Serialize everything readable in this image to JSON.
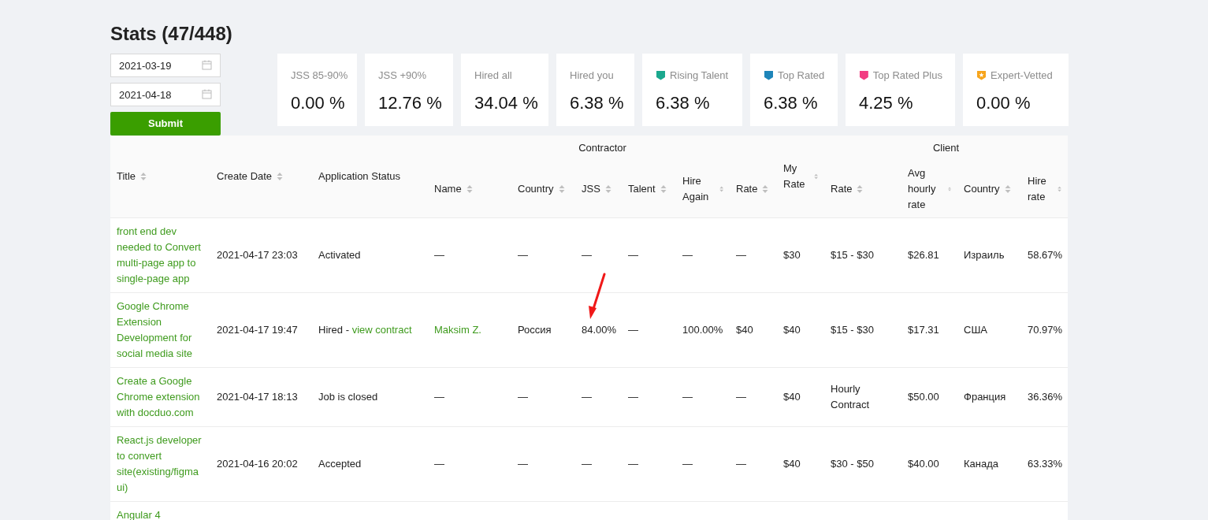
{
  "page_title": "Stats (47/448)",
  "filters": {
    "date_from": "2021-03-19",
    "date_to": "2021-04-18",
    "submit": "Submit"
  },
  "stats": [
    {
      "label": "JSS 85-90%",
      "value": "0.00 %"
    },
    {
      "label": "JSS +90%",
      "value": "12.76 %"
    },
    {
      "label": "Hired all",
      "value": "34.04 %"
    },
    {
      "label": "Hired you",
      "value": "6.38 %"
    },
    {
      "label": "Rising Talent",
      "value": "6.38 %",
      "badge": {
        "color": "#1aa88e",
        "star": false
      }
    },
    {
      "label": "Top Rated",
      "value": "6.38 %",
      "badge": {
        "color": "#1e85b9",
        "star": false
      }
    },
    {
      "label": "Top Rated Plus",
      "value": "4.25 %",
      "badge": {
        "color": "#f23d82",
        "star": false
      }
    },
    {
      "label": "Expert-Vetted",
      "value": "0.00 %",
      "badge": {
        "color": "#f7a51c",
        "star": true
      }
    }
  ],
  "table": {
    "header": [
      {
        "label": "Title",
        "sortable": true
      },
      {
        "label": "Create Date",
        "sortable": true
      },
      {
        "label": "Application Status",
        "sortable": false
      },
      {
        "group": "Contractor",
        "columns": [
          {
            "label": "Name",
            "sortable": true
          },
          {
            "label": "Country",
            "sortable": true
          },
          {
            "label": "JSS",
            "sortable": true
          },
          {
            "label": "Talent",
            "sortable": true
          },
          {
            "label": "Hire Again",
            "sortable": true
          },
          {
            "label": "Rate",
            "sortable": true
          }
        ]
      },
      {
        "label": "My Rate",
        "sortable": true
      },
      {
        "group": "Client",
        "columns": [
          {
            "label": "Rate",
            "sortable": true
          },
          {
            "label": "Avg hourly rate",
            "sortable": true
          },
          {
            "label": "Country",
            "sortable": true
          },
          {
            "label": "Hire rate",
            "sortable": true
          }
        ]
      }
    ],
    "rows": [
      {
        "cells": [
          {
            "kind": "link",
            "text": "front end dev needed to Convert multi-page app to single-page app"
          },
          {
            "kind": "text",
            "text": "2021-04-17 23:03"
          },
          {
            "kind": "text",
            "text": "Activated"
          },
          {
            "kind": "text",
            "text": "—"
          },
          {
            "kind": "text",
            "text": "—"
          },
          {
            "kind": "text",
            "text": "—"
          },
          {
            "kind": "text",
            "text": "—"
          },
          {
            "kind": "text",
            "text": "—"
          },
          {
            "kind": "text",
            "text": "—"
          },
          {
            "kind": "text",
            "text": "$30"
          },
          {
            "kind": "text",
            "text": "$15 - $30"
          },
          {
            "kind": "text",
            "text": "$26.81"
          },
          {
            "kind": "text",
            "text": "Израиль"
          },
          {
            "kind": "text",
            "text": "58.67%"
          }
        ]
      },
      {
        "cells": [
          {
            "kind": "link",
            "text": "Google Chrome Extension Development for social media site"
          },
          {
            "kind": "text",
            "text": "2021-04-17 19:47"
          },
          {
            "kind": "status",
            "text": "Hired",
            "separator": "-",
            "link": "view contract"
          },
          {
            "kind": "link",
            "text": "Maksim Z."
          },
          {
            "kind": "text",
            "text": "Россия"
          },
          {
            "kind": "text",
            "text": "84.00%",
            "annotated": true
          },
          {
            "kind": "text",
            "text": "—"
          },
          {
            "kind": "text",
            "text": "100.00%"
          },
          {
            "kind": "text",
            "text": "$40"
          },
          {
            "kind": "text",
            "text": "$40"
          },
          {
            "kind": "text",
            "text": "$15 - $30"
          },
          {
            "kind": "text",
            "text": "$17.31"
          },
          {
            "kind": "text",
            "text": "США"
          },
          {
            "kind": "text",
            "text": "70.97%"
          }
        ]
      },
      {
        "cells": [
          {
            "kind": "link",
            "text": "Create a Google Chrome extension with docduo.com"
          },
          {
            "kind": "text",
            "text": "2021-04-17 18:13"
          },
          {
            "kind": "text",
            "text": "Job is closed"
          },
          {
            "kind": "text",
            "text": "—"
          },
          {
            "kind": "text",
            "text": "—"
          },
          {
            "kind": "text",
            "text": "—"
          },
          {
            "kind": "text",
            "text": "—"
          },
          {
            "kind": "text",
            "text": "—"
          },
          {
            "kind": "text",
            "text": "—"
          },
          {
            "kind": "text",
            "text": "$40"
          },
          {
            "kind": "text",
            "text": "Hourly Contract"
          },
          {
            "kind": "text",
            "text": "$50.00"
          },
          {
            "kind": "text",
            "text": "Франция"
          },
          {
            "kind": "text",
            "text": "36.36%"
          }
        ]
      },
      {
        "cells": [
          {
            "kind": "link",
            "text": "React.js developer to convert site(existing/figma ui)"
          },
          {
            "kind": "text",
            "text": "2021-04-16 20:02"
          },
          {
            "kind": "text",
            "text": "Accepted"
          },
          {
            "kind": "text",
            "text": "—"
          },
          {
            "kind": "text",
            "text": "—"
          },
          {
            "kind": "text",
            "text": "—"
          },
          {
            "kind": "text",
            "text": "—"
          },
          {
            "kind": "text",
            "text": "—"
          },
          {
            "kind": "text",
            "text": "—"
          },
          {
            "kind": "text",
            "text": "$40"
          },
          {
            "kind": "text",
            "text": "$30 - $50"
          },
          {
            "kind": "text",
            "text": "$40.00"
          },
          {
            "kind": "text",
            "text": "Канада"
          },
          {
            "kind": "text",
            "text": "63.33%"
          }
        ]
      },
      {
        "cells": [
          {
            "kind": "link",
            "text": "Angular 4"
          }
        ]
      }
    ]
  }
}
